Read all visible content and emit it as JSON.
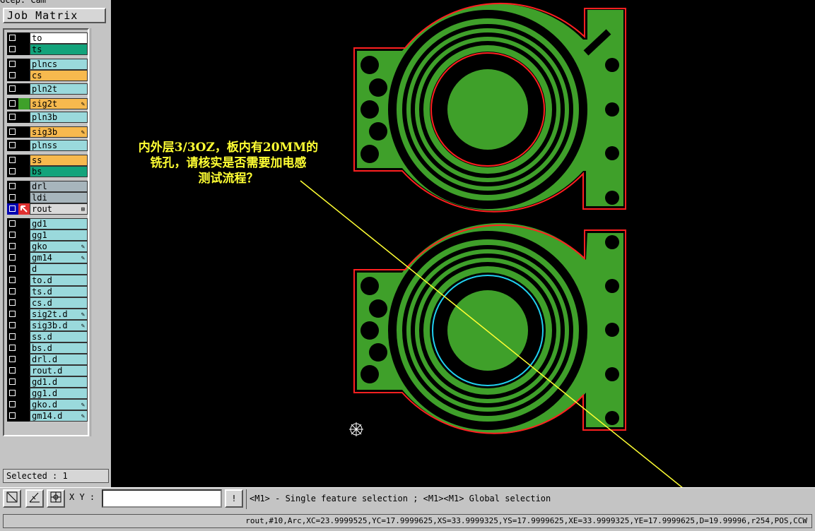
{
  "window": {
    "title_fragment": "Gcep. Cam"
  },
  "job_matrix_button": "Job Matrix ...",
  "layers": [
    {
      "name": "to",
      "color": "#ffffff",
      "affected": false,
      "flag": ""
    },
    {
      "name": "ts",
      "color": "#13a37b",
      "affected": false,
      "flag": ""
    },
    {
      "name": "plncs",
      "color": "#9ad9dc",
      "affected": false,
      "flag": ""
    },
    {
      "name": "cs",
      "color": "#f7b94e",
      "affected": false,
      "flag": ""
    },
    {
      "name": "pln2t",
      "color": "#9ad9dc",
      "affected": false,
      "flag": ""
    },
    {
      "name": "sig2t",
      "color": "#f7b94e",
      "affected": true,
      "flag": "✎"
    },
    {
      "name": "pln3b",
      "color": "#9ad9dc",
      "affected": false,
      "flag": ""
    },
    {
      "name": "sig3b",
      "color": "#f7b94e",
      "affected": false,
      "flag": "✎"
    },
    {
      "name": "plnss",
      "color": "#9ad9dc",
      "affected": false,
      "flag": ""
    },
    {
      "name": "ss",
      "color": "#f7b94e",
      "affected": false,
      "flag": ""
    },
    {
      "name": "bs",
      "color": "#13a37b",
      "affected": false,
      "flag": ""
    },
    {
      "name": "drl",
      "color": "#a7b5bc",
      "affected": false,
      "flag": ""
    },
    {
      "name": "ldi",
      "color": "#a7b5bc",
      "affected": false,
      "flag": ""
    },
    {
      "name": "rout",
      "color": "#d9d9d9",
      "affected": false,
      "flag": "⊞",
      "active": true
    },
    {
      "name": "gd1",
      "color": "#9ad9dc",
      "affected": false,
      "flag": ""
    },
    {
      "name": "gg1",
      "color": "#9ad9dc",
      "affected": false,
      "flag": ""
    },
    {
      "name": "gko",
      "color": "#9ad9dc",
      "affected": false,
      "flag": "✎"
    },
    {
      "name": "gm14",
      "color": "#9ad9dc",
      "affected": false,
      "flag": "✎"
    },
    {
      "name": "d",
      "color": "#9ad9dc",
      "affected": false,
      "flag": ""
    },
    {
      "name": "to.d",
      "color": "#9ad9dc",
      "affected": false,
      "flag": ""
    },
    {
      "name": "ts.d",
      "color": "#9ad9dc",
      "affected": false,
      "flag": ""
    },
    {
      "name": "cs.d",
      "color": "#9ad9dc",
      "affected": false,
      "flag": ""
    },
    {
      "name": "sig2t.d",
      "color": "#9ad9dc",
      "affected": false,
      "flag": "✎"
    },
    {
      "name": "sig3b.d",
      "color": "#9ad9dc",
      "affected": false,
      "flag": "✎"
    },
    {
      "name": "ss.d",
      "color": "#9ad9dc",
      "affected": false,
      "flag": ""
    },
    {
      "name": "bs.d",
      "color": "#9ad9dc",
      "affected": false,
      "flag": ""
    },
    {
      "name": "drl.d",
      "color": "#9ad9dc",
      "affected": false,
      "flag": ""
    },
    {
      "name": "rout.d",
      "color": "#9ad9dc",
      "affected": false,
      "flag": ""
    },
    {
      "name": "gd1.d",
      "color": "#9ad9dc",
      "affected": false,
      "flag": ""
    },
    {
      "name": "gg1.d",
      "color": "#9ad9dc",
      "affected": false,
      "flag": ""
    },
    {
      "name": "gko.d",
      "color": "#9ad9dc",
      "affected": false,
      "flag": "✎"
    },
    {
      "name": "gm14.d",
      "color": "#9ad9dc",
      "affected": false,
      "flag": "✎"
    }
  ],
  "selected_label": "Selected : 1",
  "annotation": [
    "内外层3/3OZ，板内有20MM的",
    "铣孔，请核实是否需要加电感",
    "测试流程？"
  ],
  "toolbar": {
    "xy_label": "X Y :",
    "xy_value": "",
    "hint": "<M1> - Single feature selection ; <M1><M1> Global selection",
    "excl_icon": "!"
  },
  "status_line": "rout,#10,Arc,XC=23.9999525,YC=17.9999625,XS=33.9999325,YS=17.9999625,XE=33.9999325,YE=17.9999625,D=19.99996,r254,POS,CCW",
  "colors": {
    "copper": "#3fa02a",
    "rout": "#ff2020",
    "selected": "#20d0f0",
    "annotation": "#ffff33",
    "background": "#000000"
  }
}
